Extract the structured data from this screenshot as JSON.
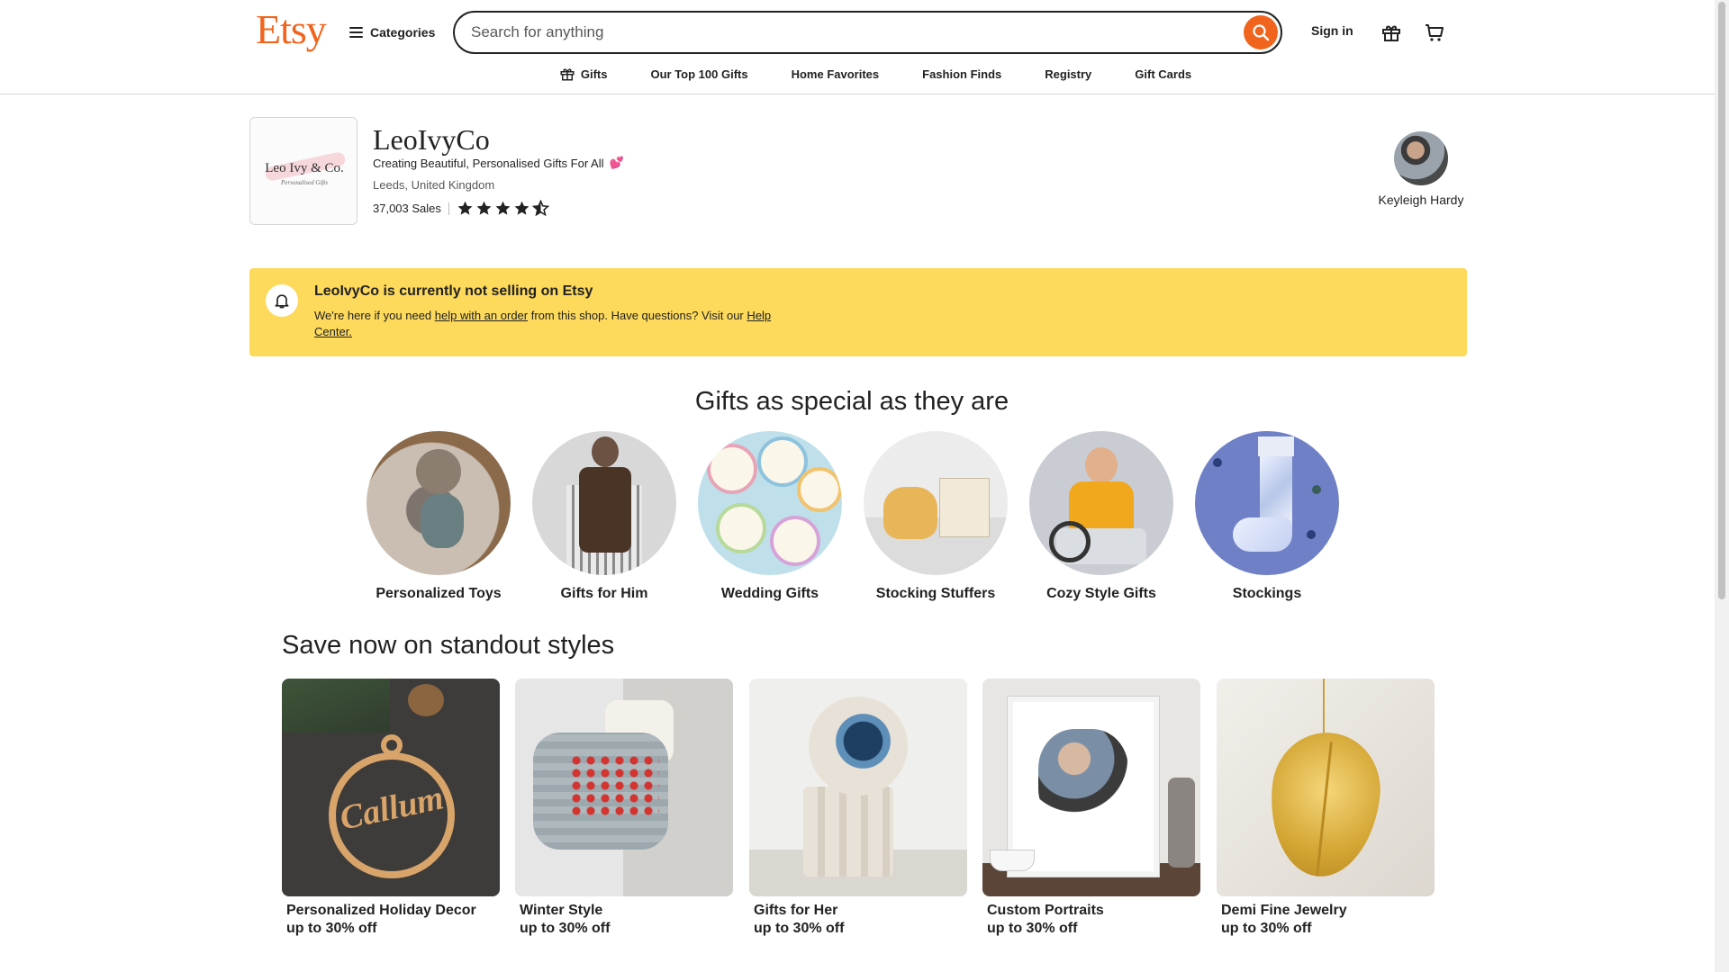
{
  "header": {
    "logo": "Etsy",
    "categories_label": "Categories",
    "search_placeholder": "Search for anything",
    "signin_label": "Sign in",
    "accent_color": "#f1641e"
  },
  "nav": {
    "items": [
      "Gifts",
      "Our Top 100 Gifts",
      "Home Favorites",
      "Fashion Finds",
      "Registry",
      "Gift Cards"
    ]
  },
  "shop": {
    "logo_text": "Leo Ivy & Co.",
    "logo_subtext": "Personalised Gifts",
    "name": "LeoIvyCo",
    "tagline": "Creating Beautiful, Personalised Gifts For All",
    "tagline_emoji": "💕",
    "location": "Leeds, United Kingdom",
    "sales": "37,003 Sales",
    "rating_stars": 4.5,
    "owner_name": "Keyleigh Hardy"
  },
  "alert": {
    "title": "LeoIvyCo is currently not selling on Etsy",
    "text_1": "We're here if you need ",
    "link_1": "help with an order",
    "text_2": " from this shop. Have questions? Visit our ",
    "link_2": "Help Center.",
    "background": "#fdd95c"
  },
  "gifts": {
    "title": "Gifts as special as they are",
    "items": [
      {
        "label": "Personalized Toys"
      },
      {
        "label": "Gifts for Him"
      },
      {
        "label": "Wedding Gifts"
      },
      {
        "label": "Stocking Stuffers"
      },
      {
        "label": "Cozy Style Gifts"
      },
      {
        "label": "Stockings"
      }
    ]
  },
  "deals": {
    "title": "Save now on standout styles",
    "items": [
      {
        "title": "Personalized Holiday Decor",
        "sub": "up to 30% off",
        "ornament_text": "Callum"
      },
      {
        "title": "Winter Style",
        "sub": "up to 30% off"
      },
      {
        "title": "Gifts for Her",
        "sub": "up to 30% off"
      },
      {
        "title": "Custom Portraits",
        "sub": "up to 30% off"
      },
      {
        "title": "Demi Fine Jewelry",
        "sub": "up to 30% off"
      }
    ]
  }
}
